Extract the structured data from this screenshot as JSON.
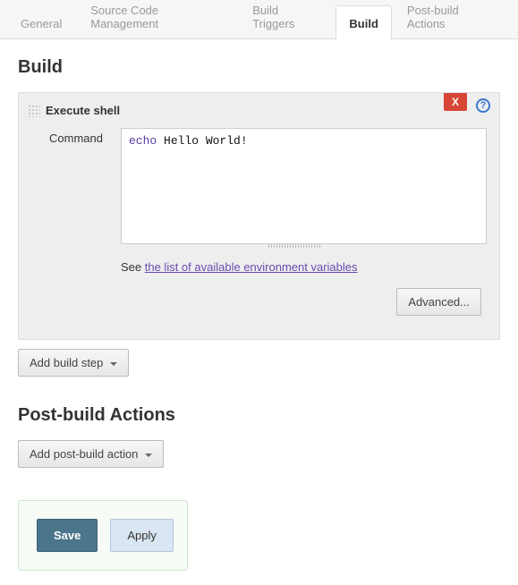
{
  "tabs": {
    "general": "General",
    "scm": "Source Code Management",
    "triggers": "Build Triggers",
    "build": "Build",
    "post": "Post-build Actions"
  },
  "build_section": {
    "title": "Build",
    "step_title": "Execute shell",
    "delete_label": "X",
    "help_char": "?",
    "command_label": "Command",
    "command_value": "echo Hello World!",
    "help_prefix": "See ",
    "help_link": "the list of available environment variables",
    "advanced": "Advanced...",
    "add_step": "Add build step"
  },
  "post_section": {
    "title": "Post-build Actions",
    "add_action": "Add post-build action"
  },
  "footer": {
    "save": "Save",
    "apply": "Apply"
  }
}
